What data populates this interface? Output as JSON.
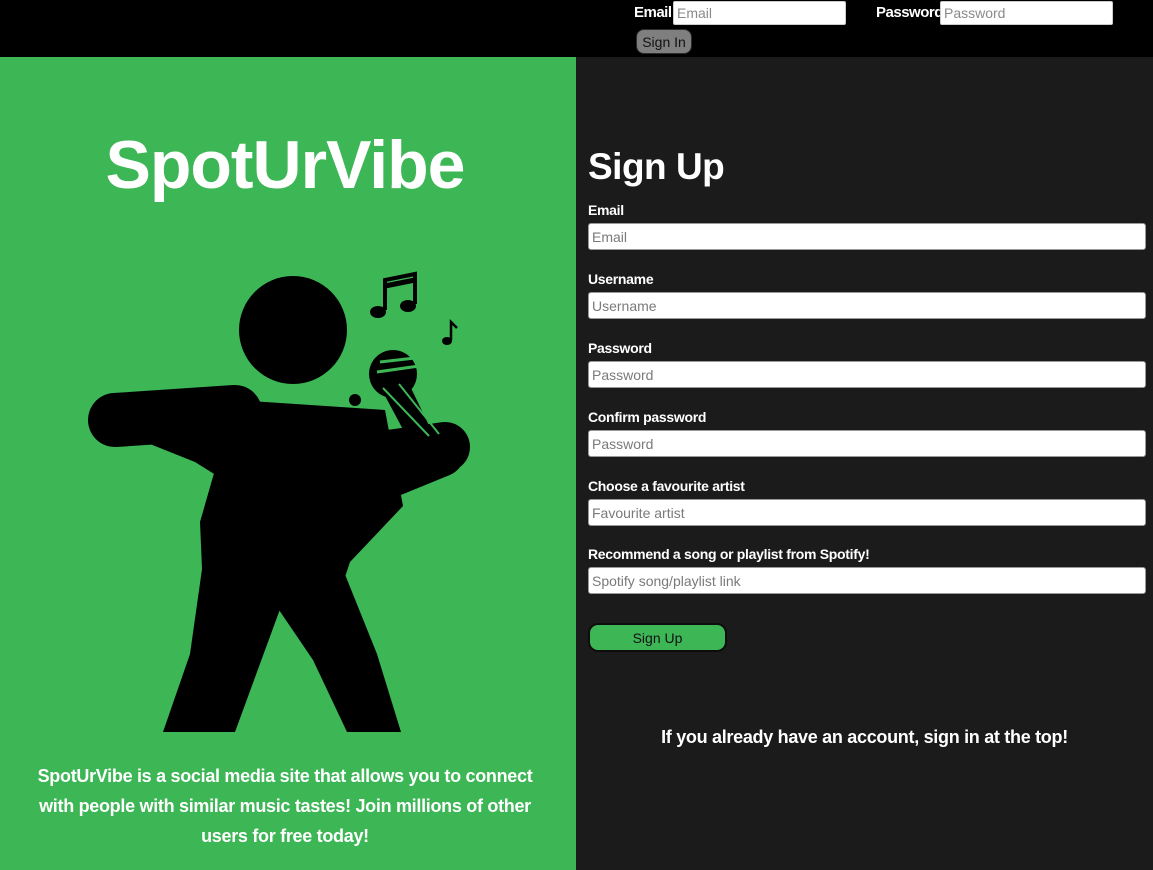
{
  "topbar": {
    "email_label": "Email",
    "email_placeholder": "Email",
    "password_label": "Password",
    "password_placeholder": "Password",
    "signin_label": "Sign In"
  },
  "left": {
    "brand": "SpotUrVibe",
    "illustration_icon": "singer-with-microphone-icon",
    "tagline": "SpotUrVibe is a social media site that allows you to connect with people with similar music tastes! Join millions of other users for free today!"
  },
  "signup": {
    "title": "Sign Up",
    "fields": [
      {
        "label": "Email",
        "placeholder": "Email"
      },
      {
        "label": "Username",
        "placeholder": "Username"
      },
      {
        "label": "Password",
        "placeholder": "Password"
      },
      {
        "label": "Confirm password",
        "placeholder": "Password"
      },
      {
        "label": "Choose a favourite artist",
        "placeholder": "Favourite artist"
      },
      {
        "label": "Recommend a song or playlist from Spotify!",
        "placeholder": "Spotify song/playlist link"
      }
    ],
    "button_label": "Sign Up",
    "signin_hint": "If you already have an account, sign in at the top!"
  },
  "colors": {
    "brand_green": "#3db656",
    "dark_panel": "#1b1b1b",
    "topbar": "#000000"
  }
}
